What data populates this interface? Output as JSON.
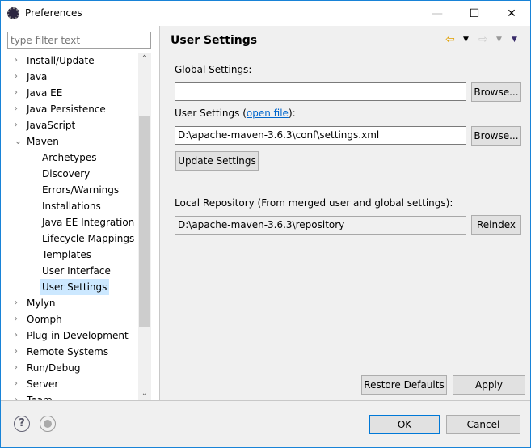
{
  "window": {
    "title": "Preferences",
    "controls": [
      "minimize",
      "maximize",
      "close"
    ]
  },
  "filter": {
    "placeholder": "type filter text"
  },
  "tree": [
    {
      "label": "Install/Update",
      "level": 0,
      "expanded": false
    },
    {
      "label": "Java",
      "level": 0,
      "expanded": false
    },
    {
      "label": "Java EE",
      "level": 0,
      "expanded": false
    },
    {
      "label": "Java Persistence",
      "level": 0,
      "expanded": false
    },
    {
      "label": "JavaScript",
      "level": 0,
      "expanded": false
    },
    {
      "label": "Maven",
      "level": 0,
      "expanded": true
    },
    {
      "label": "Archetypes",
      "level": 1
    },
    {
      "label": "Discovery",
      "level": 1
    },
    {
      "label": "Errors/Warnings",
      "level": 1
    },
    {
      "label": "Installations",
      "level": 1
    },
    {
      "label": "Java EE Integration",
      "level": 1
    },
    {
      "label": "Lifecycle Mappings",
      "level": 1
    },
    {
      "label": "Templates",
      "level": 1
    },
    {
      "label": "User Interface",
      "level": 1
    },
    {
      "label": "User Settings",
      "level": 1,
      "selected": true
    },
    {
      "label": "Mylyn",
      "level": 0,
      "expanded": false
    },
    {
      "label": "Oomph",
      "level": 0,
      "expanded": false
    },
    {
      "label": "Plug-in Development",
      "level": 0,
      "expanded": false
    },
    {
      "label": "Remote Systems",
      "level": 0,
      "expanded": false
    },
    {
      "label": "Run/Debug",
      "level": 0,
      "expanded": false
    },
    {
      "label": "Server",
      "level": 0,
      "expanded": false
    },
    {
      "label": "Team",
      "level": 0,
      "expanded": false
    }
  ],
  "page": {
    "title": "User Settings",
    "global_label": "Global Settings:",
    "global_value": "",
    "browse1": "Browse...",
    "user_label_pre": "User Settings (",
    "user_link": "open file",
    "user_label_post": "):",
    "user_value": "D:\\apache-maven-3.6.3\\conf\\settings.xml",
    "browse2": "Browse...",
    "update": "Update Settings",
    "local_label": "Local Repository (From merged user and global settings):",
    "local_value": "D:\\apache-maven-3.6.3\\repository",
    "reindex": "Reindex",
    "restore": "Restore Defaults",
    "apply": "Apply"
  },
  "footer": {
    "ok": "OK",
    "cancel": "Cancel",
    "help_icon": "?"
  },
  "colors": {
    "accent": "#0078d7",
    "link": "#0066cc",
    "selection": "#cce8ff"
  }
}
